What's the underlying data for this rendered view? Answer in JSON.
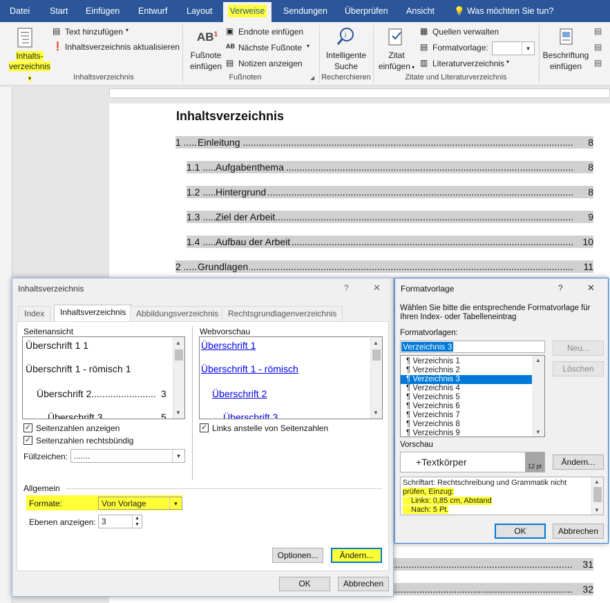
{
  "ribbon_tabs": [
    "Datei",
    "Start",
    "Einfügen",
    "Entwurf",
    "Layout",
    "Verweise",
    "Sendungen",
    "Überprüfen",
    "Ansicht"
  ],
  "tell_me": "Was möchten Sie tun?",
  "ribbon": {
    "toc_button": [
      "Inhalts-",
      "verzeichnis"
    ],
    "add_text": "Text hinzufügen",
    "update_toc": "Inhaltsverzeichnis aktualisieren",
    "group_toc": "Inhaltsverzeichnis",
    "insert_footnote": [
      "Fußnote",
      "einfügen"
    ],
    "insert_endnote": "Endnote einfügen",
    "next_footnote": "Nächste Fußnote",
    "show_notes": "Notizen anzeigen",
    "group_footnotes": "Fußnoten",
    "smart_lookup": [
      "Intelligente",
      "Suche"
    ],
    "group_research": "Recherchieren",
    "insert_citation": [
      "Zitat",
      "einfügen"
    ],
    "manage_sources": "Quellen verwalten",
    "style_label": "Formatvorlage:",
    "bibliography": "Literaturverzeichnis",
    "group_citations": "Zitate und Literaturverzeichnis",
    "insert_caption": [
      "Beschriftung",
      "einfügen"
    ],
    "ab_superscript": "1"
  },
  "document": {
    "title": "Inhaltsverzeichnis",
    "toc": [
      {
        "num": "1",
        "text": "Einleitung",
        "page": "8"
      },
      {
        "num": "1.1",
        "text": "Aufgabenthema",
        "page": "8"
      },
      {
        "num": "1.2",
        "text": "Hintergrund",
        "page": "8"
      },
      {
        "num": "1.3",
        "text": "Ziel der Arbeit",
        "page": "9"
      },
      {
        "num": "1.4",
        "text": "Aufbau der Arbeit",
        "page": "10"
      },
      {
        "num": "2",
        "text": "Grundlagen",
        "page": "11"
      }
    ],
    "bottom_pages": [
      "31",
      "32"
    ]
  },
  "toc_dialog": {
    "title": "Inhaltsverzeichnis",
    "help": "?",
    "close": "✕",
    "tabs": [
      "Index",
      "Inhaltsverzeichnis",
      "Abbildungsverzeichnis",
      "Rechtsgrundlagenverzeichnis"
    ],
    "print_preview_label": "Seitenansicht",
    "print_preview": [
      "Überschrift 1 1",
      "Überschrift 1 - römisch 1",
      "Überschrift 2",
      "Überschrift 3"
    ],
    "print_preview_pages": [
      "3",
      "5"
    ],
    "show_page_numbers": "Seitenzahlen anzeigen",
    "right_align": "Seitenzahlen rechtsbündig",
    "tab_leader_label": "Füllzeichen:",
    "tab_leader_value": ".......",
    "web_preview_label": "Webvorschau",
    "web_preview": [
      "Überschrift 1",
      "Überschrift 1 - römisch",
      "Überschrift 2",
      "Überschrift 3"
    ],
    "use_links": "Links anstelle von Seitenzahlen",
    "general_label": "Allgemein",
    "formats_label": "Formate:",
    "formats_value": "Von Vorlage",
    "levels_label": "Ebenen anzeigen:",
    "levels_value": "3",
    "options_btn": "Optionen...",
    "modify_btn": "Ändern...",
    "ok": "OK",
    "cancel": "Abbrechen"
  },
  "style_dialog": {
    "title": "Formatvorlage",
    "help": "?",
    "close": "✕",
    "instruction": "Wählen Sie bitte die entsprechende Formatvorlage für Ihren Index- oder Tabelleneintrag",
    "styles_label": "Formatvorlagen:",
    "selected": "Verzeichnis 3",
    "styles": [
      "Verzeichnis 1",
      "Verzeichnis 2",
      "Verzeichnis 3",
      "Verzeichnis 4",
      "Verzeichnis 5",
      "Verzeichnis 6",
      "Verzeichnis 7",
      "Verzeichnis 8",
      "Verzeichnis 9"
    ],
    "new_btn": "Neu...",
    "delete_btn": "Löschen",
    "preview_label": "Vorschau",
    "preview_text": "+Textkörper",
    "preview_size": "12 pt",
    "modify_btn": "Ändern...",
    "desc_line1": "Schriftart: Rechtschreibung und Grammatik nicht",
    "desc_line2": "prüfen, Einzug:",
    "desc_line3": "Links:  0,85 cm, Abstand",
    "desc_line4": "Nach:  5 Pt.",
    "ok": "OK",
    "cancel": "Abbrechen"
  },
  "colors": {
    "ribbon_blue": "#2b579a",
    "highlight": "#ffff38",
    "selection": "#0078d7"
  }
}
